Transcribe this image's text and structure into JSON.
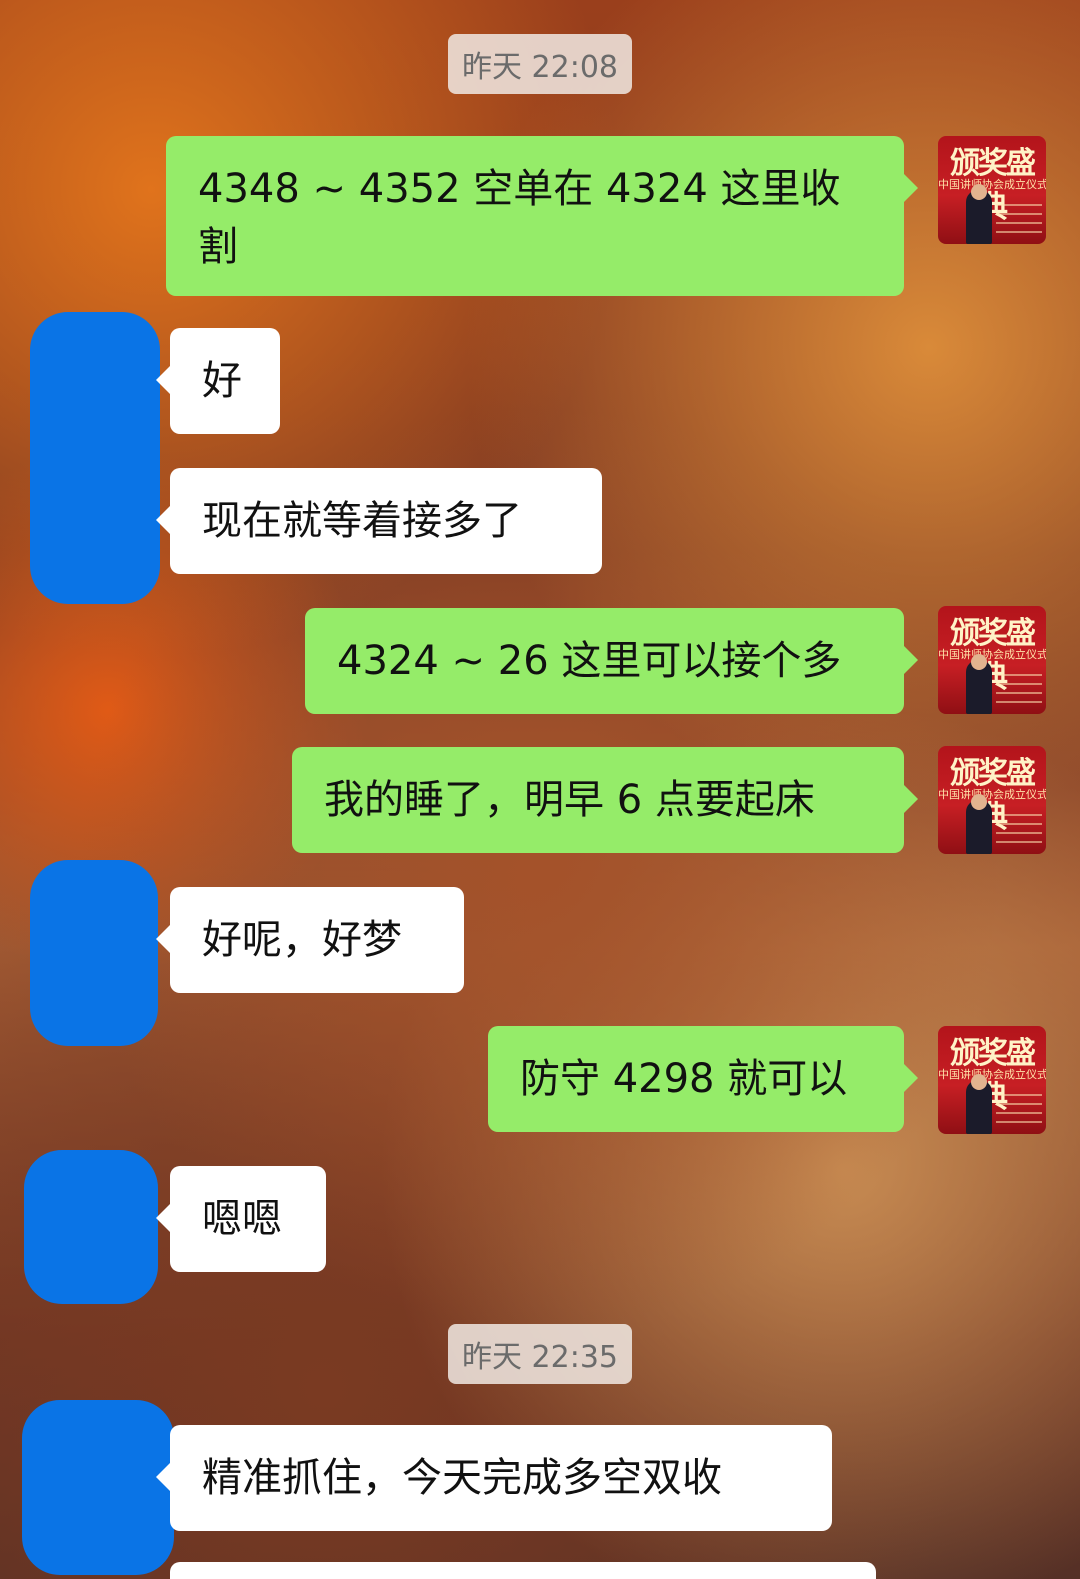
{
  "chat": {
    "timestamps": [
      "昨天 22:08",
      "昨天 22:35"
    ],
    "avatar_self": {
      "title": "颁奖盛典",
      "subtitle": "中国讲师协会成立仪式"
    },
    "messages": [
      {
        "side": "out",
        "text": "4348 ~ 4352 空单在 4324 这里收割"
      },
      {
        "side": "in",
        "text": "好"
      },
      {
        "side": "in",
        "text": "现在就等着接多了"
      },
      {
        "side": "out",
        "text": "4324 ~ 26 这里可以接个多"
      },
      {
        "side": "out",
        "text": "我的睡了，明早 6 点要起床"
      },
      {
        "side": "in",
        "text": "好呢，好梦"
      },
      {
        "side": "out",
        "text": "防守 4298 就可以"
      },
      {
        "side": "in",
        "text": "嗯嗯"
      },
      {
        "side": "in",
        "text": "精准抓住，今天完成多空双收"
      }
    ]
  },
  "colors": {
    "bubble_out": "#95ec69",
    "bubble_in": "#ffffff",
    "avatar_scribble": "#0a74e6",
    "avatar_self_bg": "#c71f24"
  }
}
